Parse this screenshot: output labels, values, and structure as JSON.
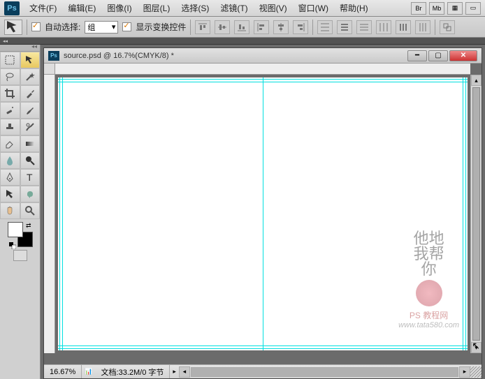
{
  "app_logo": "Ps",
  "menu": {
    "file": "文件(F)",
    "edit": "编辑(E)",
    "image": "图像(I)",
    "layer": "图层(L)",
    "select": "选择(S)",
    "filter": "滤镜(T)",
    "view": "视图(V)",
    "window": "窗口(W)",
    "help": "帮助(H)"
  },
  "right_buttons": {
    "br": "Br",
    "mb": "Mb"
  },
  "options": {
    "auto_select_label": "自动选择:",
    "group_label": "组",
    "dropdown_arrow": "▾",
    "show_transform_label": "显示变换控件"
  },
  "document": {
    "title": "source.psd @ 16.7%(CMYK/8) *"
  },
  "status": {
    "zoom": "16.67%",
    "doc_info": "文档:33.2M/0 字节"
  },
  "watermark": {
    "line1": "他地",
    "line2": "我帮",
    "line3": "你",
    "label": "PS 教程网",
    "url": "www.tata580.com"
  },
  "colors": {
    "guide": "#00e0e0",
    "foreground": "#ffffff",
    "background": "#000000"
  }
}
